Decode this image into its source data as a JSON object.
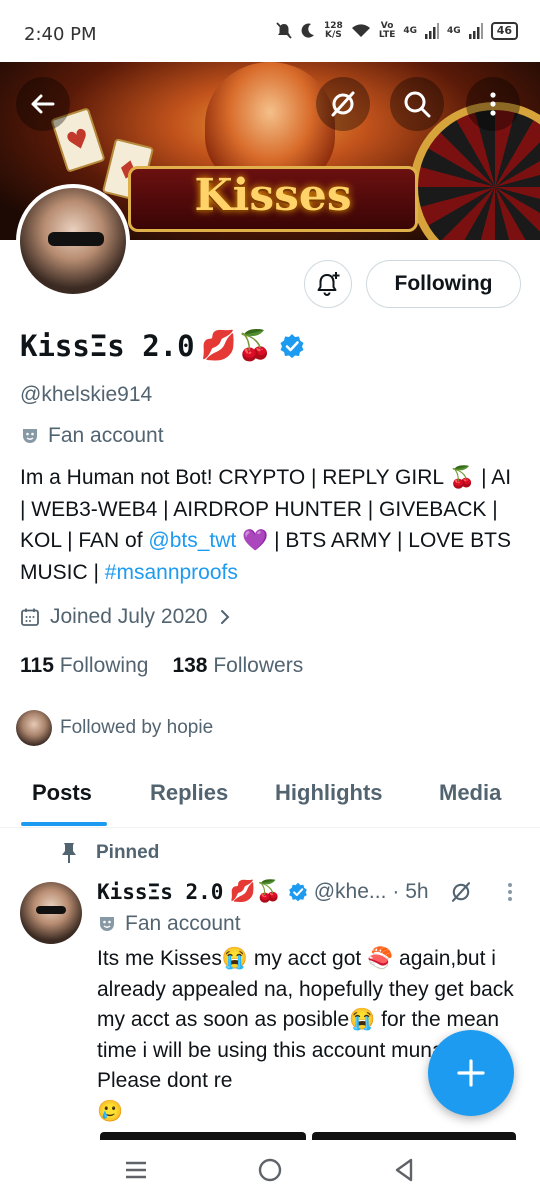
{
  "status_bar": {
    "time": "2:40 PM",
    "speed_value": "128",
    "speed_unit": "K/S",
    "volte_top": "Vo",
    "volte_bottom": "LTE",
    "net1": "4G",
    "net2": "4G",
    "battery": "46"
  },
  "banner": {
    "title": "Kisses",
    "icons": [
      "back-arrow-icon",
      "grok-icon",
      "search-icon",
      "more-vertical-icon"
    ]
  },
  "profile": {
    "display_name": "KissΞs 2.0",
    "name_emojis": "💋🍒",
    "handle": "@khelskie914",
    "account_label": "Fan account",
    "bio_parts": {
      "p1": "Im a Human not Bot! CRYPTO | REPLY GIRL 🍒 | AI | WEB3-WEB4 | AIRDROP HUNTER | GIVEBACK | KOL | FAN of ",
      "link1": "@bts_twt",
      "p2": " 💜 | BTS ARMY | LOVE BTS MUSIC | ",
      "link2": "#msannproofs"
    },
    "joined": "Joined July 2020",
    "following_count": "115",
    "following_label": "Following",
    "followers_count": "138",
    "followers_label": "Followers",
    "followed_by": "Followed by hopie",
    "follow_button": "Following"
  },
  "tabs": [
    "Posts",
    "Replies",
    "Highlights",
    "Media"
  ],
  "active_tab": "Posts",
  "post": {
    "pinned_label": "Pinned",
    "author_name": "KissΞs 2.0",
    "author_emojis": "💋🍒",
    "author_handle": "@khe...",
    "time": "· 5h",
    "account_label": "Fan account",
    "text": "Its me Kisses😭 my acct got 🍣 again,but i already appealed na, hopefully they get back my acct as soon as posible😭 for the mean time i will be using this account muna🙏 Please dont re",
    "text_end": "🥲"
  },
  "colors": {
    "accent": "#1d9bf0",
    "text_primary": "#0f1419",
    "text_secondary": "#536471",
    "border": "#cfd9de"
  },
  "nav": [
    "recent-apps-icon",
    "home-circle-icon",
    "back-triangle-icon"
  ]
}
